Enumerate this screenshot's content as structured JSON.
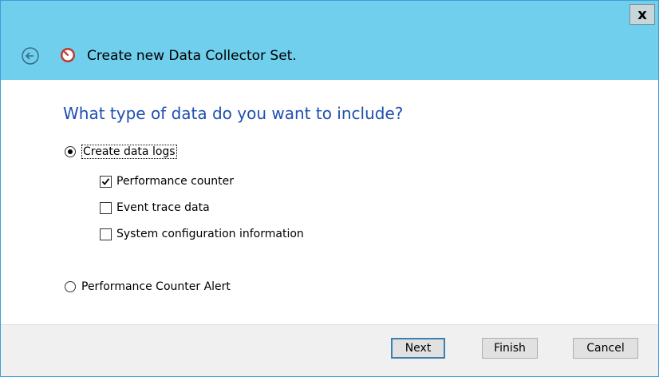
{
  "window": {
    "close_label": "x",
    "title": "Create new Data Collector Set."
  },
  "content": {
    "heading": "What type of data do you want to include?",
    "options": {
      "create_data_logs": {
        "label": "Create data logs",
        "selected": true
      },
      "performance_counter_alert": {
        "label": "Performance Counter Alert",
        "selected": false
      }
    },
    "checkboxes": [
      {
        "label": "Performance counter",
        "checked": true
      },
      {
        "label": "Event trace data",
        "checked": false
      },
      {
        "label": "System configuration information",
        "checked": false
      }
    ]
  },
  "footer": {
    "next_label": "Next",
    "finish_label": "Finish",
    "cancel_label": "Cancel"
  },
  "icons": {
    "back": "back-arrow-icon",
    "app": "performance-monitor-icon",
    "radio": "radio-icon",
    "check": "checkmark-icon"
  },
  "colors": {
    "titlebar": "#6fcfec",
    "heading": "#1f4fb0",
    "footer": "#f0f0f0"
  }
}
